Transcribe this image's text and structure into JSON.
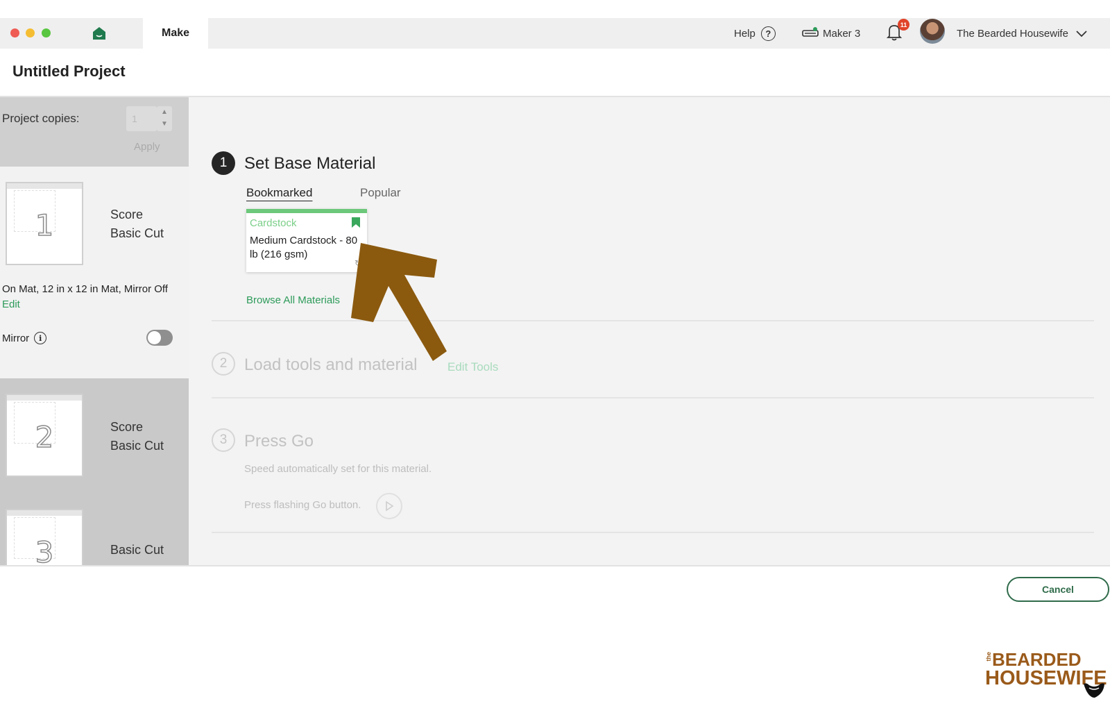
{
  "titlebar": {
    "tab_label": "Make",
    "help_label": "Help",
    "help_glyph": "?",
    "machine_label": "Maker 3",
    "notification_count": "11",
    "user_name": "The Bearded Housewife"
  },
  "project": {
    "title": "Untitled Project"
  },
  "sidebar": {
    "copies_label": "Project copies:",
    "copies_value": "1",
    "apply_label": "Apply",
    "mats": [
      {
        "number": "1",
        "line1": "Score",
        "line2": "Basic Cut"
      },
      {
        "number": "2",
        "line1": "Score",
        "line2": "Basic Cut"
      },
      {
        "number": "3",
        "line1": "Basic Cut"
      }
    ],
    "mat_info": "On Mat, 12 in x 12 in Mat, Mirror Off",
    "edit_label": "Edit",
    "mirror_label": "Mirror",
    "info_glyph": "i"
  },
  "steps": {
    "step1": {
      "number": "1",
      "title": "Set Base Material",
      "tabs": [
        "Bookmarked",
        "Popular"
      ],
      "card": {
        "category": "Cardstock",
        "name": "Medium Cardstock - 80 lb (216 gsm)"
      },
      "browse_label": "Browse All Materials"
    },
    "step2": {
      "number": "2",
      "title": "Load tools and material",
      "edit_tools_label": "Edit Tools"
    },
    "step3": {
      "number": "3",
      "title": "Press Go",
      "speed_text": "Speed automatically set for this material.",
      "press_text": "Press flashing Go button."
    }
  },
  "footer": {
    "cancel_label": "Cancel"
  },
  "watermark": {
    "the": "the",
    "line1": "BEARDED",
    "line2": "HOUSEWIFE"
  },
  "colors": {
    "accent_green": "#2d9b5a",
    "card_green": "#6cc87a",
    "arrow_brown": "#8b5a0f",
    "brand_brown": "#9a5a1a"
  },
  "icons": [
    "home-icon",
    "help-icon",
    "machine-icon",
    "bell-icon",
    "chevron-down-icon",
    "bookmark-icon",
    "info-icon",
    "play-icon",
    "arrow-pointer"
  ]
}
